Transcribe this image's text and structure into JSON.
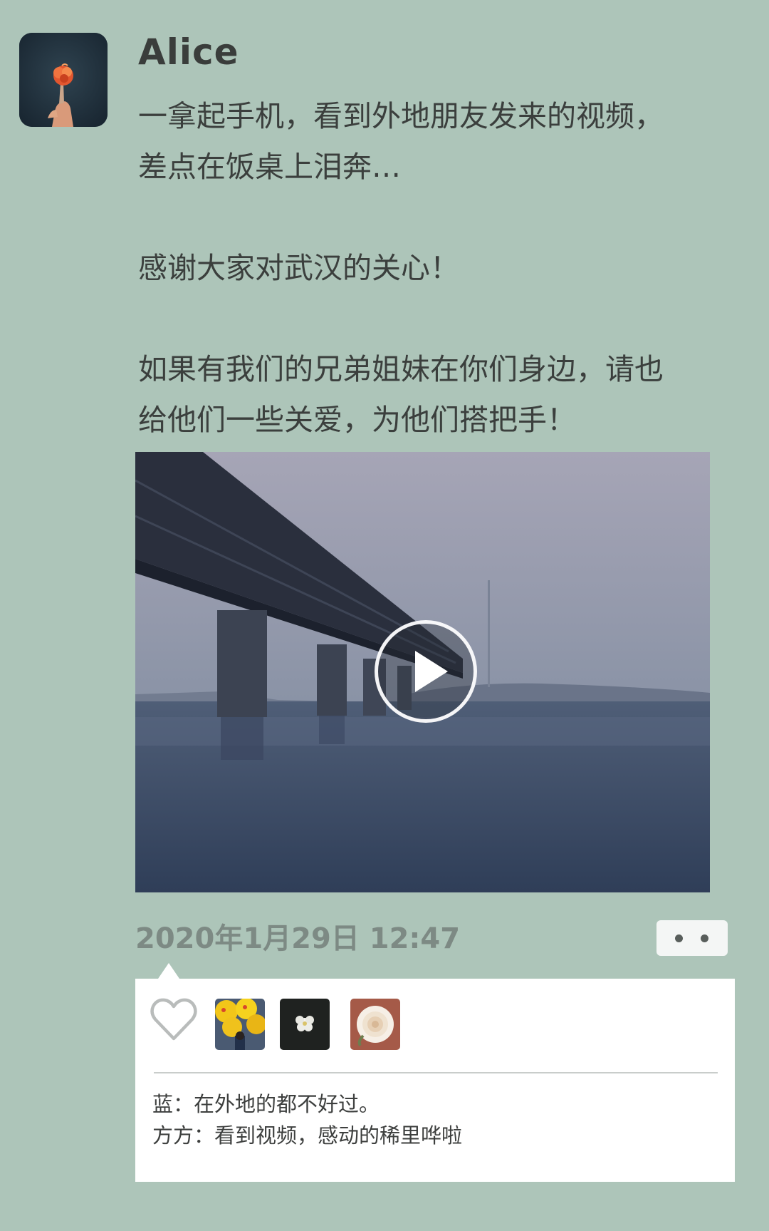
{
  "post": {
    "username": "Alice",
    "paragraphs": [
      [
        "一拿起手机，看到外地朋友发来的视频，",
        "差点在饭桌上泪奔…"
      ],
      [
        "感谢大家对武汉的关心！"
      ],
      [
        "如果有我们的兄弟姐妹在你们身边，请也",
        "给他们一些关爱，为他们搭把手！"
      ]
    ],
    "timestamp": "2020年1月29日 12:47"
  },
  "video": {
    "icon": "play-icon"
  },
  "likes": {
    "icon": "heart-outline-icon",
    "avatars": [
      "yellow-balloons-avatar",
      "white-flower-avatar",
      "rose-avatar"
    ]
  },
  "comments": [
    {
      "author": "蓝",
      "text": "在外地的都不好过。",
      "display": "蓝：在外地的都不好过。"
    },
    {
      "author": "方方",
      "text": "看到视频，感动的稀里哗啦",
      "display": "方方：看到视频，感动的稀里哗啦"
    }
  ],
  "colors": {
    "background": "#adc5b9",
    "panel": "#ffffff",
    "timestamp": "#7d8a84",
    "text": "#3b3f3d"
  }
}
